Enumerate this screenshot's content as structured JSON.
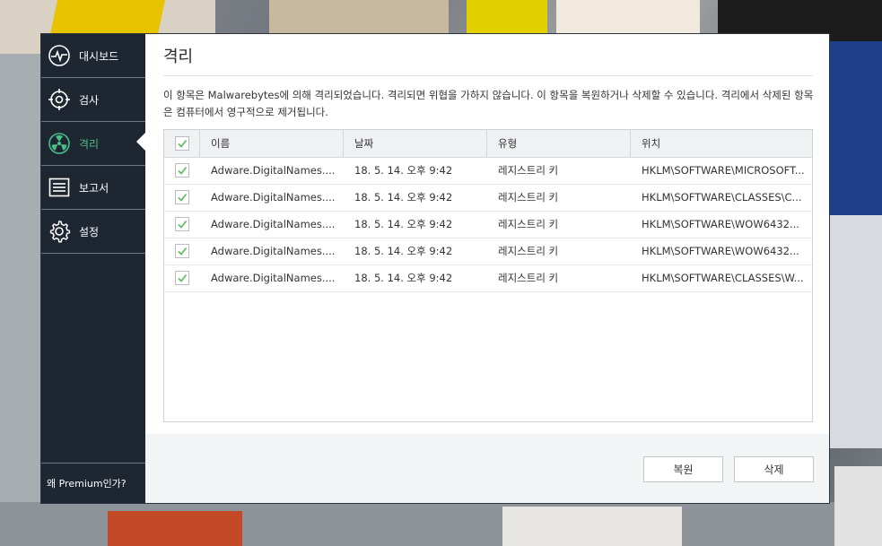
{
  "sidebar": {
    "items": [
      {
        "label": "대시보드",
        "icon": "pulse-icon"
      },
      {
        "label": "검사",
        "icon": "target-icon"
      },
      {
        "label": "격리",
        "icon": "radiation-icon"
      },
      {
        "label": "보고서",
        "icon": "report-icon"
      },
      {
        "label": "설정",
        "icon": "gear-icon"
      }
    ],
    "premium_link": "왜 Premium인가?"
  },
  "main": {
    "title": "격리",
    "description": "이 항목은 Malwarebytes에 의해 격리되었습니다. 격리되면 위협을 가하지 않습니다. 이 항목을 복원하거나 삭제할 수 있습니다. 격리에서 삭제된 항목은 컴퓨터에서 영구적으로 제거됩니다.",
    "table": {
      "headers": {
        "name": "이름",
        "date": "날짜",
        "type": "유형",
        "location": "위치"
      },
      "rows": [
        {
          "name": "Adware.DigitalNames....",
          "date": "18. 5. 14. 오후 9:42",
          "type": "레지스트리 키",
          "location": "HKLM\\SOFTWARE\\MICROSOFT..."
        },
        {
          "name": "Adware.DigitalNames....",
          "date": "18. 5. 14. 오후 9:42",
          "type": "레지스트리 키",
          "location": "HKLM\\SOFTWARE\\CLASSES\\C..."
        },
        {
          "name": "Adware.DigitalNames....",
          "date": "18. 5. 14. 오후 9:42",
          "type": "레지스트리 키",
          "location": "HKLM\\SOFTWARE\\WOW6432..."
        },
        {
          "name": "Adware.DigitalNames....",
          "date": "18. 5. 14. 오후 9:42",
          "type": "레지스트리 키",
          "location": "HKLM\\SOFTWARE\\WOW6432..."
        },
        {
          "name": "Adware.DigitalNames....",
          "date": "18. 5. 14. 오후 9:42",
          "type": "레지스트리 키",
          "location": "HKLM\\SOFTWARE\\CLASSES\\W..."
        }
      ]
    },
    "buttons": {
      "restore": "복원",
      "delete": "삭제"
    }
  },
  "colors": {
    "sidebar_bg": "#1e2632",
    "accent_green": "#49c089",
    "check_green": "#5cb85c"
  }
}
